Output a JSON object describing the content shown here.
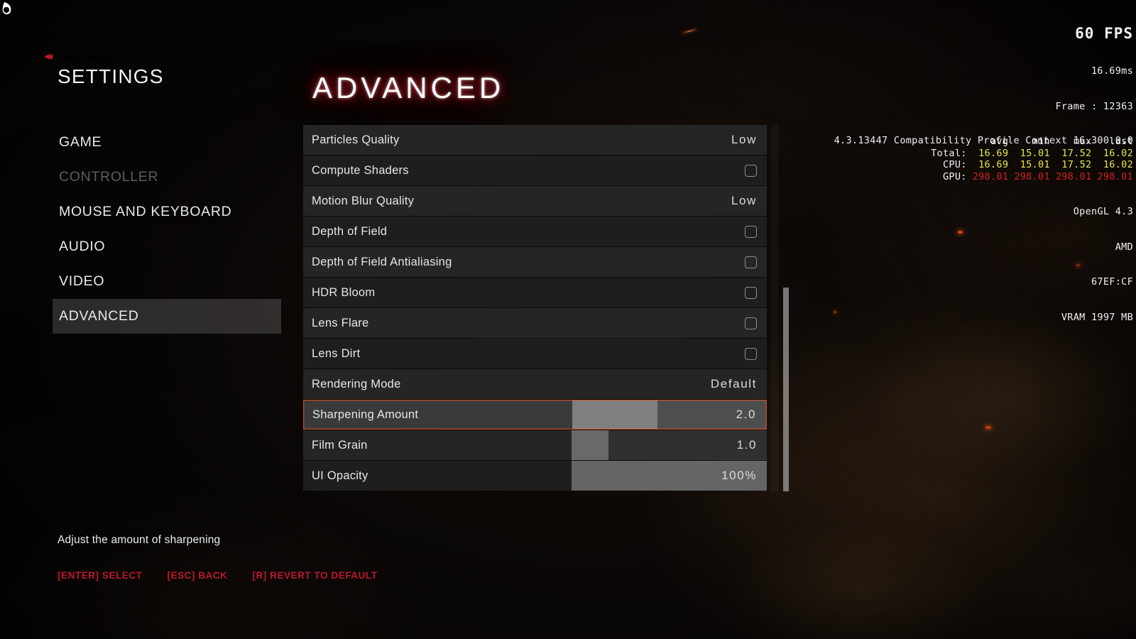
{
  "header": {
    "back_label": "CAMPAIGN",
    "back_icon": "double-chevron-left-icon",
    "screen_title": "SETTINGS",
    "page_title": "ADVANCED",
    "accent_red": "#c0162c",
    "highlight_orange": "#bf4a2c"
  },
  "sidebar": {
    "items": [
      {
        "label": "GAME",
        "state": "normal"
      },
      {
        "label": "CONTROLLER",
        "state": "disabled"
      },
      {
        "label": "MOUSE AND KEYBOARD",
        "state": "normal"
      },
      {
        "label": "AUDIO",
        "state": "normal"
      },
      {
        "label": "VIDEO",
        "state": "normal"
      },
      {
        "label": "ADVANCED",
        "state": "active"
      }
    ]
  },
  "settings": {
    "rows": [
      {
        "label": "Particles Quality",
        "type": "value",
        "value": "Low"
      },
      {
        "label": "Compute Shaders",
        "type": "checkbox",
        "checked": false
      },
      {
        "label": "Motion Blur Quality",
        "type": "value",
        "value": "Low"
      },
      {
        "label": "Depth of Field",
        "type": "checkbox",
        "checked": false
      },
      {
        "label": "Depth of Field Antialiasing",
        "type": "checkbox",
        "checked": false
      },
      {
        "label": "HDR Bloom",
        "type": "checkbox",
        "checked": false
      },
      {
        "label": "Lens Flare",
        "type": "checkbox",
        "checked": false
      },
      {
        "label": "Lens Dirt",
        "type": "checkbox",
        "checked": false
      },
      {
        "label": "Rendering Mode",
        "type": "value",
        "value": "Default"
      },
      {
        "label": "Sharpening Amount",
        "type": "slider",
        "value": "2.0",
        "fill_pct": 44,
        "selected": true
      },
      {
        "label": "Film Grain",
        "type": "slider",
        "value": "1.0",
        "fill_pct": 19
      },
      {
        "label": "UI Opacity",
        "type": "slider",
        "value": "100%",
        "fill_pct": 100
      }
    ]
  },
  "footer": {
    "description": "Adjust the amount of sharpening",
    "hints": [
      "[ENTER] SELECT",
      "[ESC] BACK",
      "[R] REVERT TO DEFAULT"
    ]
  },
  "perf_overlay": {
    "fps": "60 FPS",
    "frametime": "16.69ms",
    "frame": "Frame : 12363",
    "columns": [
      "avg",
      "min",
      "max",
      "last"
    ],
    "rows": [
      {
        "name": "Total:",
        "color": "yellow",
        "values": [
          "16.69",
          "15.01",
          "17.52",
          "16.02"
        ]
      },
      {
        "name": "CPU:",
        "color": "yellow",
        "values": [
          "16.69",
          "15.01",
          "17.52",
          "16.02"
        ]
      },
      {
        "name": "GPU:",
        "color": "red",
        "values": [
          "298.01",
          "298.01",
          "298.01",
          "298.01"
        ]
      }
    ],
    "api": "OpenGL 4.3",
    "vendor": "AMD",
    "device_id": "67EF:CF",
    "vram": "VRAM 1997 MB",
    "driver_string": "4.3.13447 Compatibility Profile Context 16.300.0.0",
    "yellow": "#e6e64b",
    "red": "#d61f1f"
  }
}
